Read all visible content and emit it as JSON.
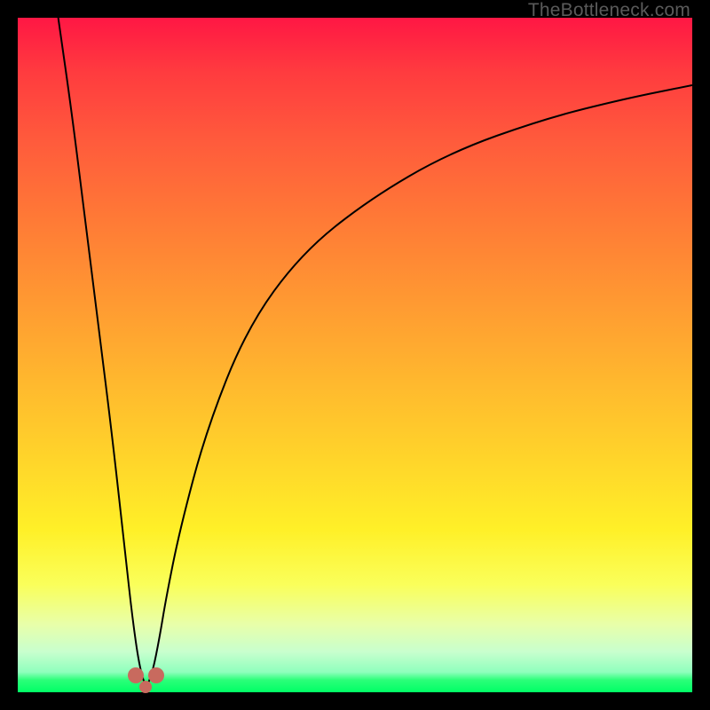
{
  "watermark": "TheBottleneck.com",
  "gradient_stops": [
    {
      "pct": 0,
      "color": "#ff1744"
    },
    {
      "pct": 18,
      "color": "#ff5a3c"
    },
    {
      "pct": 42,
      "color": "#ff9932"
    },
    {
      "pct": 66,
      "color": "#ffd62a"
    },
    {
      "pct": 84,
      "color": "#faff5a"
    },
    {
      "pct": 94,
      "color": "#c8ffce"
    },
    {
      "pct": 100,
      "color": "#00ff66"
    }
  ],
  "chart_data": {
    "type": "line",
    "title": "",
    "xlabel": "",
    "ylabel": "",
    "xlim": [
      0,
      100
    ],
    "ylim": [
      0,
      100
    ],
    "note": "Trough reaches green band around x≈19; left arm steep, right arm asymptotic toward ~90 at x=100. Two rounded pinkish markers sit at the bottom of the trough.",
    "trough_x": 19,
    "series": [
      {
        "name": "curve",
        "x": [
          6,
          8,
          10,
          12,
          14,
          16,
          17,
          18,
          19,
          20,
          21,
          22,
          24,
          28,
          34,
          42,
          52,
          64,
          78,
          90,
          100
        ],
        "values": [
          100,
          86,
          70,
          54,
          38,
          20,
          11,
          4,
          0.5,
          3,
          8,
          14,
          24,
          39,
          54,
          65,
          73,
          80,
          85,
          88,
          90
        ]
      }
    ],
    "markers": [
      {
        "name": "trough-left-marker",
        "x": 17.5,
        "y": 2.5,
        "size": 18,
        "color": "#c86a5e"
      },
      {
        "name": "trough-right-marker",
        "x": 20.5,
        "y": 2.5,
        "size": 18,
        "color": "#c86a5e"
      },
      {
        "name": "trough-bottom-marker",
        "x": 19.0,
        "y": 0.8,
        "size": 14,
        "color": "#c86a5e"
      }
    ]
  }
}
